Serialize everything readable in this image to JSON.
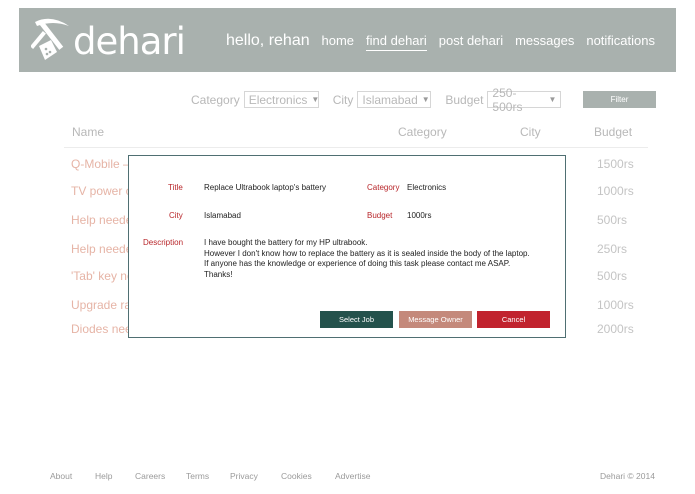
{
  "header": {
    "brand": "dehari",
    "greeting": "hello, rehan",
    "nav": [
      "home",
      "find dehari",
      "post dehari",
      "messages",
      "notifications"
    ],
    "active_nav": "find dehari",
    "colors": {
      "header_bg": "#a9b1ae"
    }
  },
  "filters": {
    "category_label": "Category",
    "category_value": "Electronics",
    "city_label": "City",
    "city_value": "Islamabad",
    "budget_label": "Budget",
    "budget_value": "250-500rs",
    "filter_button": "Filter"
  },
  "table": {
    "columns": [
      "Name",
      "Category",
      "City",
      "Budget"
    ],
    "rows": [
      {
        "name": "Q-Mobile –",
        "budget": "1500rs"
      },
      {
        "name": "TV power c",
        "budget": "1000rs"
      },
      {
        "name": "Help neede",
        "budget": "500rs"
      },
      {
        "name": "Help neede",
        "budget": "250rs"
      },
      {
        "name": "'Tab' key no",
        "budget": "500rs"
      },
      {
        "name": "Upgrade ra",
        "budget": "1000rs"
      },
      {
        "name": "Diodes nee",
        "budget": "2000rs"
      }
    ]
  },
  "modal": {
    "title_label": "Title",
    "title_value": "Replace Ultrabook laptop's battery",
    "category_label": "Category",
    "category_value": "Electronics",
    "city_label": "City",
    "city_value": "Islamabad",
    "budget_label": "Budget",
    "budget_value": "1000rs",
    "description_label": "Description",
    "description_lines": [
      "I have bought the battery for my HP ultrabook.",
      "However I don't know how to replace the battery as it is sealed inside the body of the laptop.",
      "If anyone has the knowledge or experience of doing this task please contact me ASAP.",
      "Thanks!"
    ],
    "select_button": "Select Job",
    "message_button": "Message Owner",
    "cancel_button": "Cancel",
    "colors": {
      "select": "#24524c",
      "message": "#c4897b",
      "cancel": "#c1232e",
      "label": "#b8262a"
    }
  },
  "footer": {
    "links": [
      "About",
      "Help",
      "Careers",
      "Terms",
      "Privacy",
      "Cookies",
      "Advertise"
    ],
    "copyright": "Dehari © 2014"
  }
}
